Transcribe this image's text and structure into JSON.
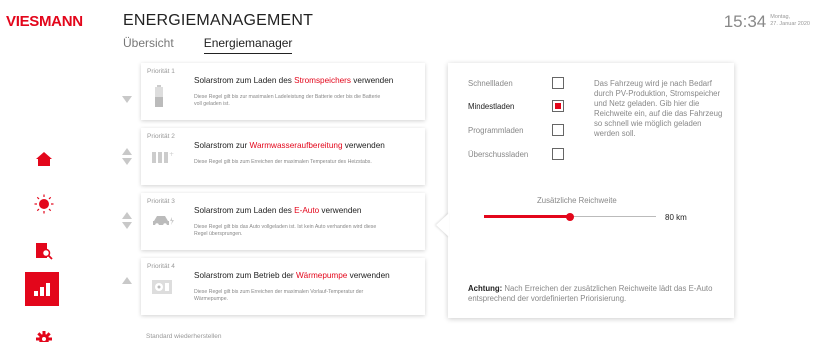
{
  "brand": {
    "logo": "VIESMANN",
    "accent": "#e3061b"
  },
  "header": {
    "title": "ENERGIEMANAGEMENT",
    "tabs": [
      {
        "label": "Übersicht",
        "active": false
      },
      {
        "label": "Energiemanager",
        "active": true
      }
    ]
  },
  "clock": {
    "time": "15:34",
    "day": "Montag,",
    "date": "27. Januar 2020"
  },
  "sidenav": {
    "items": [
      {
        "name": "home-icon",
        "active": false
      },
      {
        "name": "sun-icon",
        "active": false
      },
      {
        "name": "report-icon",
        "active": false
      },
      {
        "name": "energy-icon",
        "active": true
      },
      {
        "name": "gear-icon",
        "active": false
      }
    ]
  },
  "priorities": [
    {
      "label": "Priorität 1",
      "title_pre": "Solarstrom zum Laden des ",
      "title_hl": "Stromspeichers",
      "title_post": " verwenden",
      "desc": "Diese Regel gilt bis zur maximalen Ladeleistung der Batterie oder bis die Batterie voll geladen ist.",
      "icon": "battery-icon"
    },
    {
      "label": "Priorität 2",
      "title_pre": "Solarstrom zur ",
      "title_hl": "Warmwasseraufbereitung",
      "title_post": " verwenden",
      "desc": "Diese Regel gilt bis zum Erreichen der maximalen Temperatur des Heizstabs.",
      "icon": "heater-icon"
    },
    {
      "label": "Priorität 3",
      "title_pre": "Solarstrom zum Laden des ",
      "title_hl": "E-Auto",
      "title_post": " verwenden",
      "desc": "Diese Regel gilt bis das Auto vollgeladen ist. Ist kein Auto verhanden wird diese Regel übersprungen.",
      "icon": "car-icon"
    },
    {
      "label": "Priorität 4",
      "title_pre": "Solarstrom zum Betrieb der ",
      "title_hl": "Wärmepumpe",
      "title_post": " verwenden",
      "desc": "Diese Regel gilt bis zum Erreichen der maximalen Vorlauf-Temperatur der Wärmepumpe.",
      "icon": "heatpump-icon"
    }
  ],
  "panel": {
    "options": [
      {
        "label": "Schnellladen",
        "checked": false
      },
      {
        "label": "Mindestladen",
        "checked": true
      },
      {
        "label": "Programmladen",
        "checked": false
      },
      {
        "label": "Überschussladen",
        "checked": false
      }
    ],
    "info": "Das Fahrzeug wird je nach Bedarf durch PV-Produktion, Stromspeicher und Netz geladen. Gib hier die Reichweite ein, auf die das Fahrzeug so schnell wie möglich geladen werden soll.",
    "range_label": "Zusätzliche Reichweite",
    "range_value": "80 km",
    "range_fraction": 0.5,
    "note_bold": "Achtung:",
    "note_text": " Nach Erreichen der zusätzlichen Reichweite lädt das E-Auto entsprechend der vordefinierten Priorisierung."
  },
  "footer": {
    "reset": "Standard wiederherstellen"
  }
}
